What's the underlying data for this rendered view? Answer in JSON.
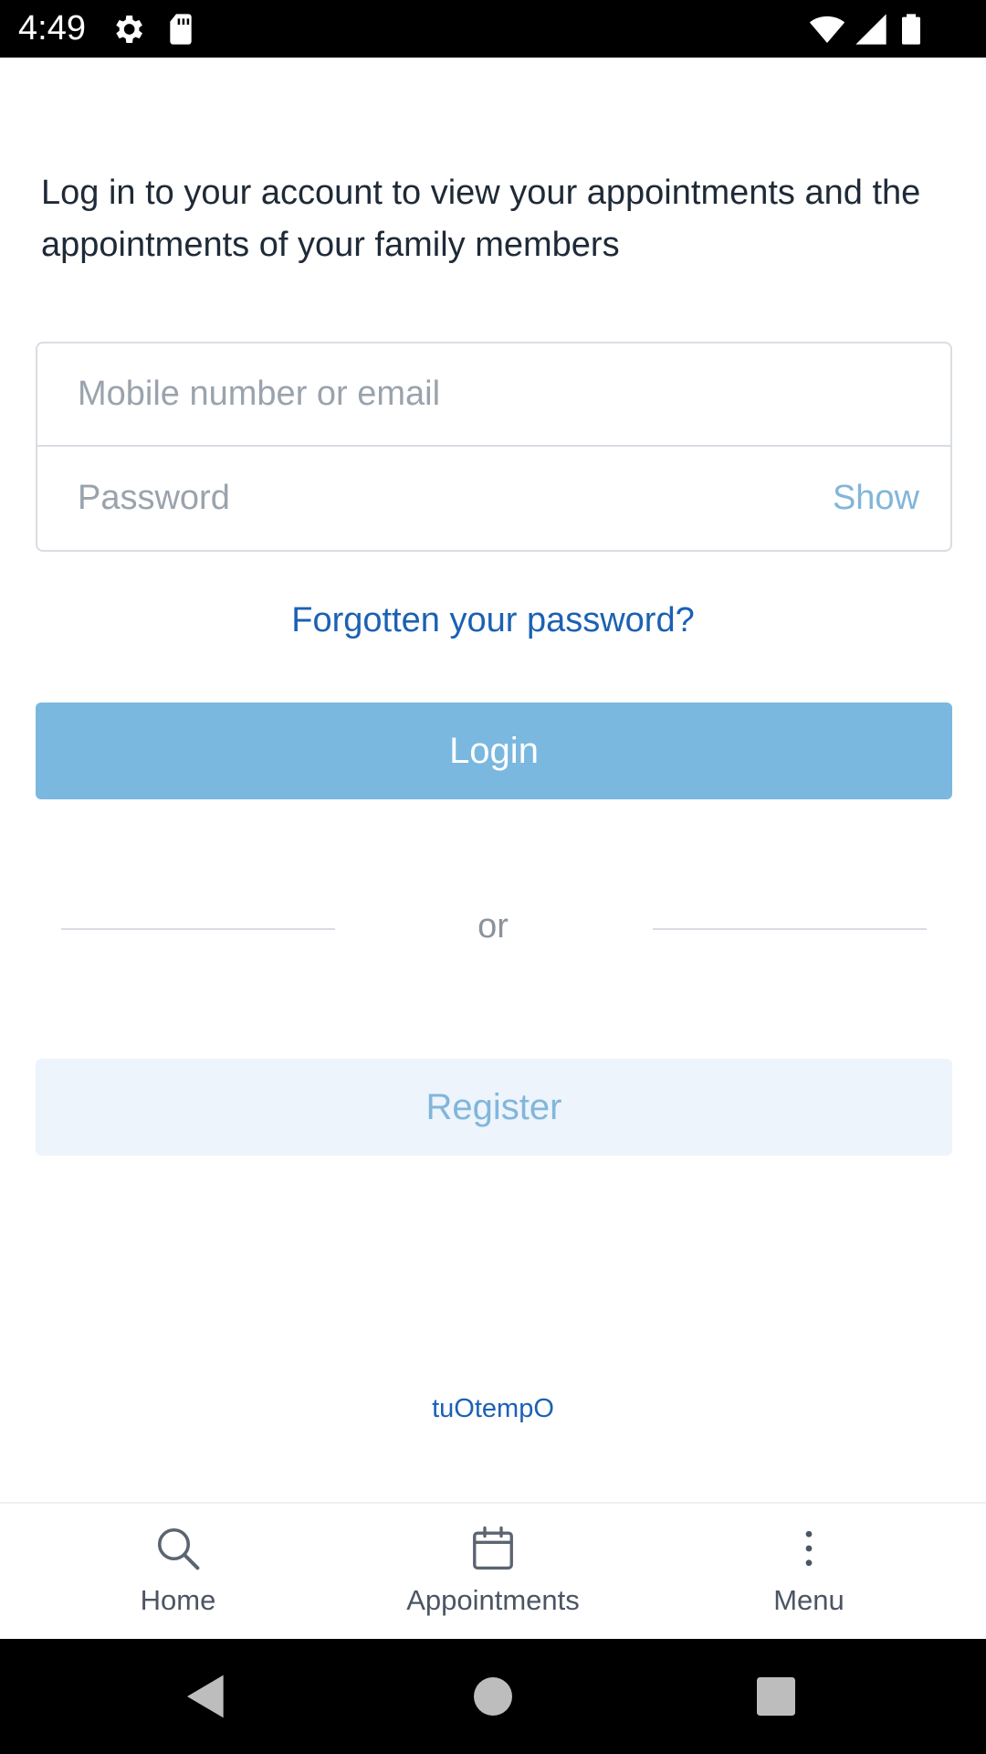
{
  "status_bar": {
    "time": "4:49",
    "icons_left": [
      "gear-icon",
      "sd-card-icon"
    ],
    "icons_right": [
      "wifi-icon",
      "signal-icon",
      "battery-icon"
    ]
  },
  "intro_text": "Log in to your account to view your appointments and the appointments of your family members",
  "form": {
    "email_placeholder": "Mobile number or email",
    "password_placeholder": "Password",
    "show_label": "Show"
  },
  "forgot_password": "Forgotten your password?",
  "login_label": "Login",
  "or_label": "or",
  "register_label": "Register",
  "brand": "tuOtempO",
  "bottom_nav": {
    "items": [
      {
        "label": "Home",
        "icon": "search-icon"
      },
      {
        "label": "Appointments",
        "icon": "calendar-icon"
      },
      {
        "label": "Menu",
        "icon": "more-vertical-icon"
      }
    ]
  },
  "system_nav": [
    "back-icon",
    "home-circle-icon",
    "recents-icon"
  ],
  "colors": {
    "primary_link": "#1b61b3",
    "login_button": "#7ab8e0",
    "register_bg": "#edf4fc",
    "register_text": "#82b6da",
    "text_dark": "#1f2a37",
    "placeholder": "#9aa3ad"
  }
}
